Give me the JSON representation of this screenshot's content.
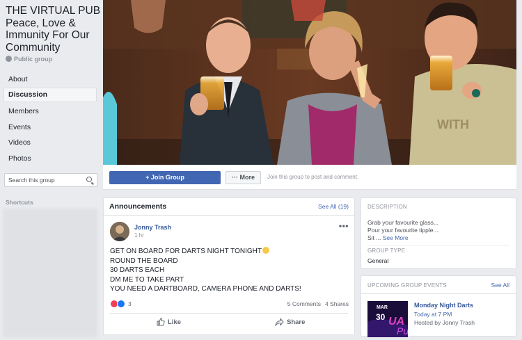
{
  "group": {
    "title": "THE VIRTUAL PUB Peace, Love & Immunity For Our Community",
    "type": "Public group"
  },
  "nav": [
    {
      "label": "About"
    },
    {
      "label": "Discussion",
      "active": true
    },
    {
      "label": "Members"
    },
    {
      "label": "Events"
    },
    {
      "label": "Videos"
    },
    {
      "label": "Photos"
    }
  ],
  "search": {
    "placeholder": "Search this group"
  },
  "shortcuts": {
    "label": "Shortcuts"
  },
  "join_bar": {
    "join_label": "+ Join Group",
    "more_label": "··· More",
    "hint": "Join this group to post and comment."
  },
  "announcements": {
    "title": "Announcements",
    "see_all": "See All (19)",
    "post": {
      "author": "Jonny Trash",
      "time": "1 hr",
      "lines": [
        "GET ON BOARD FOR DARTS NIGHT TONIGHT",
        "ROUND THE BOARD",
        "30 DARTS EACH",
        "DM ME TO TAKE PART",
        "YOU NEED A DARTBOARD, CAMERA PHONE AND DARTS!"
      ],
      "reaction_count": "3",
      "comments": "5 Comments",
      "shares": "4 Shares",
      "like_label": "Like",
      "share_label": "Share"
    }
  },
  "description": {
    "heading": "DESCRIPTION",
    "line1": "Grab your favourite glass...",
    "line2": "Pour your favourite tipple...",
    "line3": "Sit ...",
    "see_more": "See More",
    "group_type_heading": "GROUP TYPE",
    "group_type_value": "General"
  },
  "events": {
    "heading": "UPCOMING GROUP EVENTS",
    "see_all": "See All",
    "thumb_month": "MAR",
    "thumb_day": "30",
    "title": "Monday Night Darts",
    "time": "Today at 7 PM",
    "host": "Hosted by Jonny Trash"
  },
  "colors": {
    "brand": "#4267b2",
    "link": "#365899",
    "page_bg": "#e9ebee",
    "love": "#f33e58",
    "like": "#1877f2"
  }
}
